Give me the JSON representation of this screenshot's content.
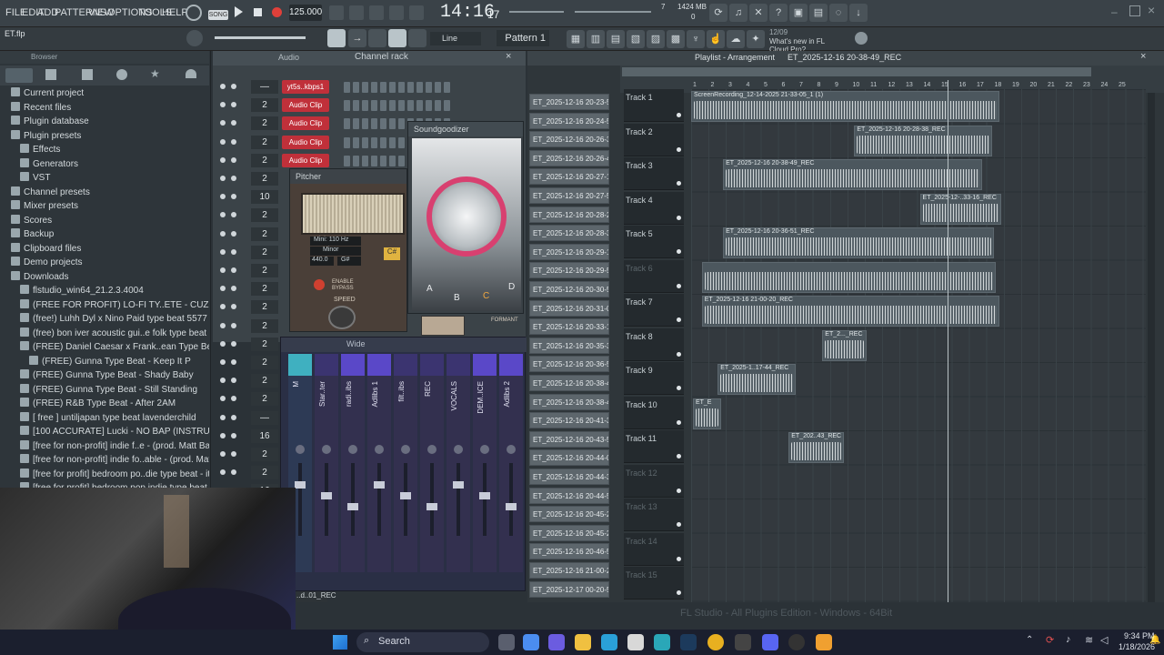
{
  "menu": [
    "FILE",
    "EDIT",
    "ADD",
    "PATTERNS",
    "VIEW",
    "OPTIONS",
    "TOOLS",
    "HELP"
  ],
  "song_mode": "SONG",
  "tempo": "125.000",
  "time": "14:16",
  "time_sub": "17",
  "cpu": {
    "num": "7",
    "mem": "1424 MB",
    "val": "0"
  },
  "project_file": "ET.flp",
  "snap": "Line",
  "pattern": "Pattern 1",
  "news": {
    "date": "12/09",
    "text": "What's new in FL Cloud Pro?"
  },
  "browser": {
    "title": "Browser",
    "items": [
      {
        "label": "Current project",
        "indent": 0
      },
      {
        "label": "Recent files",
        "indent": 0
      },
      {
        "label": "Plugin database",
        "indent": 0
      },
      {
        "label": "Plugin presets",
        "indent": 0
      },
      {
        "label": "Effects",
        "indent": 1
      },
      {
        "label": "Generators",
        "indent": 1
      },
      {
        "label": "VST",
        "indent": 1
      },
      {
        "label": "Channel presets",
        "indent": 0
      },
      {
        "label": "Mixer presets",
        "indent": 0
      },
      {
        "label": "Scores",
        "indent": 0
      },
      {
        "label": "Backup",
        "indent": 0
      },
      {
        "label": "Clipboard files",
        "indent": 0
      },
      {
        "label": "Demo projects",
        "indent": 0
      },
      {
        "label": "Downloads",
        "indent": 0
      },
      {
        "label": "flstudio_win64_21.2.3.4004",
        "indent": 1
      },
      {
        "label": "(FREE FOR PROFIT) LO-FI TY..ETE - CUZ IDONT EVEN KNOW",
        "indent": 1
      },
      {
        "label": "(free!) Luhh Dyl x Nino Paid type beat 5577",
        "indent": 1
      },
      {
        "label": "(free) bon iver  acoustic gui..e folk type beat - laying here",
        "indent": 1
      },
      {
        "label": "(FREE) Daniel Caesar x Frank..ean Type Beat - Tied To You",
        "indent": 1
      },
      {
        "label": "(FREE) Gunna Type Beat - Keep It P",
        "indent": 2
      },
      {
        "label": "(FREE) Gunna Type Beat - Shady Baby",
        "indent": 1
      },
      {
        "label": "(FREE) Gunna Type Beat - Still Standing",
        "indent": 1
      },
      {
        "label": "(FREE) R&B Type Beat - After 2AM",
        "indent": 1
      },
      {
        "label": "[ free ] untiljapan type beat lavenderchild",
        "indent": 1
      },
      {
        "label": "[100 ACCURATE] Lucki - NO BAP (INSTRUMENTAL)",
        "indent": 1
      },
      {
        "label": "[free for non-profit] indie f..e - (prod. Matt Bartkus) (1)",
        "indent": 1
      },
      {
        "label": "[free for non-profit] indie fo..able - (prod. Matt Bartkus)",
        "indent": 1
      },
      {
        "label": "[free for profit] bedroom po..die type beat - its done (1)",
        "indent": 1
      },
      {
        "label": "[free for profit] bedroom pop  indie type beat - its done",
        "indent": 1
      }
    ]
  },
  "channel_rack": {
    "title": "Channel rack",
    "group": "Audio",
    "channels": [
      {
        "num": "—",
        "name": "yt5s..kbps1"
      },
      {
        "num": "2",
        "name": "Audio Clip"
      },
      {
        "num": "2",
        "name": "Audio Clip"
      },
      {
        "num": "2",
        "name": "Audio Clip"
      },
      {
        "num": "2",
        "name": "Audio Clip"
      },
      {
        "num": "2",
        "name": ""
      },
      {
        "num": "10",
        "name": ""
      },
      {
        "num": "2",
        "name": ""
      },
      {
        "num": "2",
        "name": ""
      },
      {
        "num": "2",
        "name": ""
      },
      {
        "num": "2",
        "name": ""
      },
      {
        "num": "2",
        "name": ""
      },
      {
        "num": "2",
        "name": ""
      },
      {
        "num": "2",
        "name": ""
      },
      {
        "num": "2",
        "name": ""
      },
      {
        "num": "2",
        "name": ""
      },
      {
        "num": "2",
        "name": ""
      },
      {
        "num": "2",
        "name": ""
      },
      {
        "num": "—",
        "name": ""
      },
      {
        "num": "16",
        "name": ""
      },
      {
        "num": "2",
        "name": ""
      },
      {
        "num": "2",
        "name": ""
      },
      {
        "num": "16",
        "name": ""
      }
    ]
  },
  "plugins": {
    "soundgoodizer": {
      "title": "Soundgoodizer",
      "letters": [
        "A",
        "B",
        "C",
        "D"
      ]
    },
    "pitcher": {
      "title": "Pitcher",
      "mini": "Mini: 110 Hz",
      "scale": "Minor",
      "freq": "440.0",
      "key": "G#",
      "enable": "ENABLE",
      "bypass": "BYPASS",
      "speed": "SPEED",
      "formant": "FORMANT"
    }
  },
  "mixer": {
    "title": "Wide",
    "strips": [
      "M",
      "Star..ter",
      "radi..ibs",
      "Adlibs 1",
      "filt..ibs",
      "REC",
      "VOCALS",
      "DEM..ICE",
      "Adlibs 2"
    ],
    "bottom": "..d..01_REC"
  },
  "playlist": {
    "title": "Playlist - Arrangement",
    "pattern": "ET_2025-12-16 20-38-49_REC",
    "ruler": [
      "1",
      "2",
      "3",
      "4",
      "5",
      "6",
      "7",
      "8",
      "9",
      "10",
      "11",
      "12",
      "13",
      "14",
      "15",
      "16",
      "17",
      "18",
      "19",
      "20",
      "21",
      "22",
      "23",
      "24",
      "25"
    ],
    "patterns": [
      "ET_2025-12-16 20-23-5..",
      "ET_2025-12-16 20-24-5..",
      "ET_2025-12-16 20-26-3..",
      "ET_2025-12-16 20-26-4..",
      "ET_2025-12-16 20-27-1..",
      "ET_2025-12-16 20-27-5..",
      "ET_2025-12-16 20-28-2..",
      "ET_2025-12-16 20-28-3..",
      "ET_2025-12-16 20-29-1..",
      "ET_2025-12-16 20-29-5..",
      "ET_2025-12-16 20-30-5..",
      "ET_2025-12-16 20-31-0..",
      "ET_2025-12-16 20-33-1..",
      "ET_2025-12-16 20-35-3..",
      "ET_2025-12-16 20-36-5..",
      "ET_2025-12-16 20-38-4..",
      "ET_2025-12-16 20-38-4..",
      "ET_2025-12-16 20-41-3..",
      "ET_2025-12-16 20-43-5..",
      "ET_2025-12-16 20-44-0..",
      "ET_2025-12-16 20-44-3..",
      "ET_2025-12-16 20-44-5..",
      "ET_2025-12-16 20-45-2..",
      "ET_2025-12-16 20-45-2..",
      "ET_2025-12-16 20-46-5..",
      "ET_2025-12-16 21-00-2..",
      "ET_2025-12-17 00-20-5.."
    ],
    "tracks": [
      "Track 1",
      "Track 2",
      "Track 3",
      "Track 4",
      "Track 5",
      "Track 6",
      "Track 7",
      "Track 8",
      "Track 9",
      "Track 10",
      "Track 11",
      "Track 12",
      "Track 13",
      "Track 14",
      "Track 15"
    ],
    "clips": [
      {
        "track": 0,
        "start": 1,
        "len": 17.4,
        "label": "ScreenRecording_12-14-2025 21-33-05_1 (1)"
      },
      {
        "track": 1,
        "start": 10.2,
        "len": 7.8,
        "label": "ET_2025-12-16 20-28-38_REC"
      },
      {
        "track": 2,
        "start": 2.8,
        "len": 14.6,
        "label": "ET_2025-12-16 20-38-49_REC"
      },
      {
        "track": 3,
        "start": 13.9,
        "len": 4.6,
        "label": "ET_2025-12-..33-16_REC"
      },
      {
        "track": 4,
        "start": 2.8,
        "len": 15.3,
        "label": "ET_2025-12-16 20-36-51_REC"
      },
      {
        "track": 5,
        "start": 1.6,
        "len": 16.6,
        "label": ""
      },
      {
        "track": 6,
        "start": 1.6,
        "len": 16.8,
        "label": "ET_2025-12-16 21-00-20_REC"
      },
      {
        "track": 7,
        "start": 8.4,
        "len": 2.5,
        "label": "ET_2..._REC"
      },
      {
        "track": 8,
        "start": 2.5,
        "len": 4.4,
        "label": "ET_2025-1..17-44_REC"
      },
      {
        "track": 9,
        "start": 1.1,
        "len": 1.6,
        "label": "ET_E"
      },
      {
        "track": 10,
        "start": 6.5,
        "len": 3.1,
        "label": "ET_202..43_REC"
      }
    ]
  },
  "hint": "FL Studio - All Plugins Edition - Windows - 64Bit",
  "taskbar": {
    "search": "Search",
    "time": "9:34 PM",
    "date": "1/18/2026"
  }
}
